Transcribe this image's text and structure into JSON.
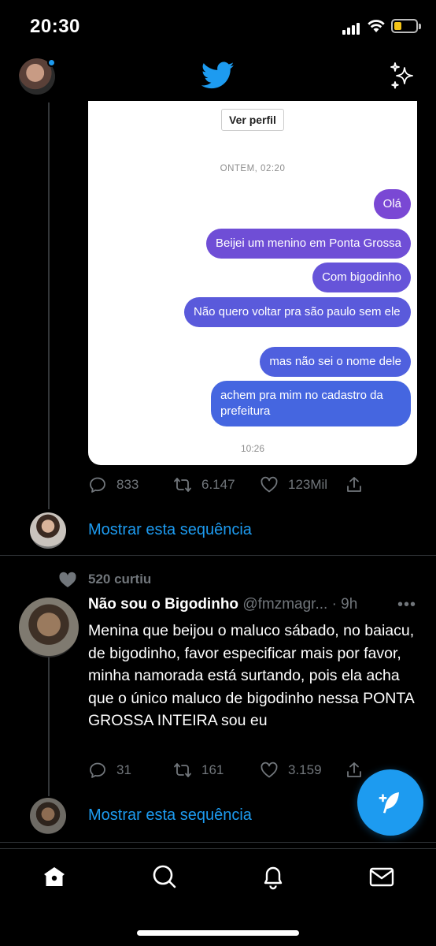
{
  "status_bar": {
    "time": "20:30"
  },
  "colors": {
    "bubble_top": "#7b4bd6",
    "bubble_bottom": "#3f6ae2",
    "twitter_blue": "#1d9bf0",
    "muted": "#71767b"
  },
  "dm": {
    "view_profile_label": "Ver perfil",
    "date_label": "ONTEM, 02:20",
    "messages": [
      "Olá",
      "Beijei um menino em Ponta Grossa",
      "Com bigodinho",
      "Não quero voltar pra são paulo sem ele",
      "mas não sei o nome dele",
      "achem pra mim no cadastro da prefeitura"
    ],
    "time_label": "10:26"
  },
  "first_tweet": {
    "replies": "833",
    "retweets": "6.147",
    "likes": "123Mil",
    "show_thread": "Mostrar esta sequência"
  },
  "second_tweet": {
    "liked_by": "520 curtiu",
    "name": "Não sou o Bigodinho",
    "handle": "@fmzmagr...",
    "time": "· 9h",
    "more": "•••",
    "text": "Menina que beijou o maluco sábado, no baiacu, de bigodinho, favor especificar mais por favor,  minha namorada está surtando, pois ela acha que o único maluco de bigodinho nessa PONTA GROSSA INTEIRA sou eu",
    "replies": "31",
    "retweets": "161",
    "likes": "3.159",
    "show_thread": "Mostrar esta sequência"
  },
  "icons": {
    "header_left": "profile-avatar",
    "header_center": "twitter-bird-icon",
    "header_right": "sparkle-icon",
    "nav": [
      "home-icon",
      "search-icon",
      "bell-icon",
      "mail-icon"
    ],
    "fab": "compose-feather-icon"
  }
}
